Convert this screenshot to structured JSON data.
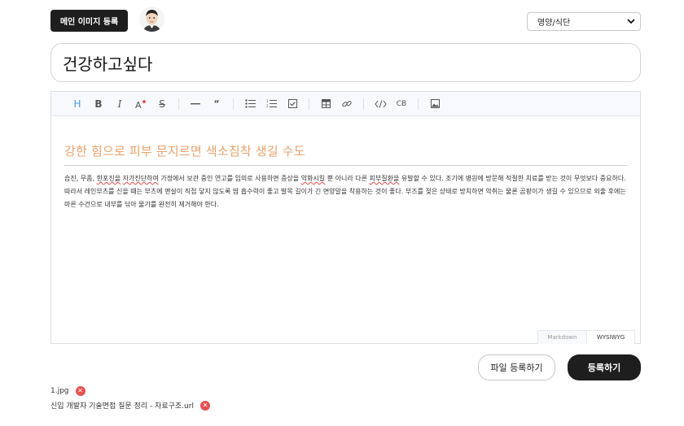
{
  "header": {
    "main_image_button": "메인 이미지 등록",
    "category": {
      "selected": "영양/식단"
    }
  },
  "title": {
    "value": "건강하고싶다"
  },
  "editor": {
    "heading": "강한 힘으로 피부 문지르면 색소침착 생길 수도",
    "paragraph_parts": [
      "습진, 무좀, ",
      "한포진을",
      " ",
      "자가진단하여",
      " 가정에서 보관 중인 연고를 임의로 사용하면 증상을 ",
      "악화시킬",
      " 뿐 아니라 다른 ",
      "피부질환을",
      " 유발할 수 있다. 조기에 병원에 방문해 적절한 치료를 받는 것이 무엇보다 중요하다. 따라서 레인부츠를 신을 때는 부츠에 맨살이 직접 닿지 않도록 땀 흡수력이 좋고 발목 길이가 긴 면양말을 착용하는 것이 좋다. 부츠를 젖은 상태로 방치하면 악취는 물론 곰팡이가 생길 수 있으므로 외출 후에는 마른 수건으로 내부를 닦아 물기를 완전히 제거해야 한다."
    ],
    "modes": [
      "Markdown",
      "WYSIWYG"
    ],
    "selected_mode": "WYSIWYG",
    "toolbar_icons": [
      "heading-icon",
      "bold-icon",
      "italic-icon",
      "text-color-icon",
      "strike-icon",
      "hr-icon",
      "quote-icon",
      "ul-icon",
      "ol-icon",
      "task-icon",
      "table-icon",
      "link-icon",
      "code-icon",
      "codeblock-icon",
      "image-icon"
    ]
  },
  "actions": {
    "file_button": "파일 등록하기",
    "submit_button": "등록하기"
  },
  "files": [
    {
      "name": "1.jpg"
    },
    {
      "name": "신입 개발자 기술면접 질문 정리 - 자료구조.url"
    }
  ],
  "colors": {
    "dark": "#1e1e1e",
    "heading": "#e8a26b",
    "toolbar_active": "#4b96e6",
    "remove": "#e55252"
  }
}
